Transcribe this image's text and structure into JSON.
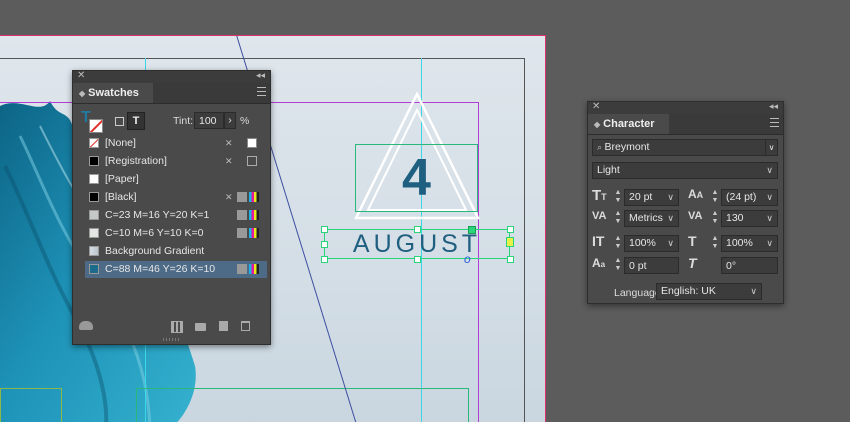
{
  "swatches": {
    "title": "Swatches",
    "tint_label": "Tint:",
    "tint_value": "100",
    "percent": "%",
    "items": [
      {
        "name": "[None]",
        "color": "none"
      },
      {
        "name": "[Registration]",
        "color": "#000000"
      },
      {
        "name": "[Paper]",
        "color": "#ffffff"
      },
      {
        "name": "[Black]",
        "color": "#000000"
      },
      {
        "name": "C=23 M=16 Y=20 K=1",
        "color": "#c4c8c6"
      },
      {
        "name": "C=10 M=6 Y=10 K=0",
        "color": "#e3e6e2"
      },
      {
        "name": "Background Gradient",
        "color": "#d6dde3"
      },
      {
        "name": "C=88 M=46 Y=26 K=10",
        "color": "#1b6b8c"
      }
    ],
    "selected_index": 7
  },
  "character": {
    "title": "Character",
    "font_family": "Breymont",
    "font_style": "Light",
    "font_size": "20 pt",
    "leading": "(24 pt)",
    "kerning": "Metrics",
    "tracking": "130",
    "vertical_scale": "100%",
    "horizontal_scale": "100%",
    "baseline_shift": "0 pt",
    "skew": "0°",
    "language_label": "Language:",
    "language_value": "English: UK"
  },
  "document": {
    "day": "4",
    "month": "AUGUST",
    "accent": "#1f5f80"
  }
}
